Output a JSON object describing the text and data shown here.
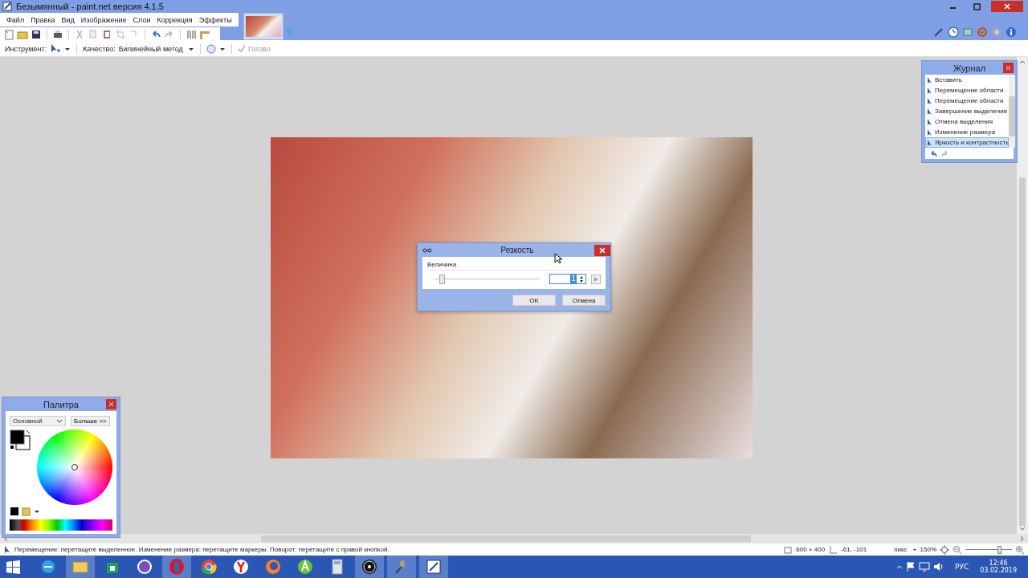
{
  "window": {
    "title": "Безымянный - paint.net версия 4.1.5"
  },
  "menu": [
    "Файл",
    "Правка",
    "Вид",
    "Изображение",
    "Слои",
    "Коррекция",
    "Эффекты"
  ],
  "tool_options": {
    "tool_label": "Инструмент:",
    "quality_label": "Качество:",
    "quality_value": "Билинейный метод",
    "done_label": "Готово"
  },
  "history": {
    "title": "Журнал",
    "items": [
      {
        "label": "Вставить",
        "selected": false
      },
      {
        "label": "Перемещение области",
        "selected": false
      },
      {
        "label": "Перемещение области",
        "selected": false
      },
      {
        "label": "Завершение выделения",
        "selected": false
      },
      {
        "label": "Отмена выделения",
        "selected": false
      },
      {
        "label": "Изменение размера",
        "selected": false
      },
      {
        "label": "Яркость и контрастность",
        "selected": true
      }
    ]
  },
  "palette": {
    "title": "Палитра",
    "mode": "Основной",
    "more_button": "Больше >>"
  },
  "dialog": {
    "title": "Резкость",
    "group_label": "Величина",
    "slider": {
      "level": 0.06
    },
    "value": "1",
    "ok": "OK",
    "cancel": "Отмена"
  },
  "status_bar": {
    "hint": "Перемещение: перетащите выделенное. Изменение размера: перетащите маркеры. Поворот: перетащите с правой кнопкой.",
    "image_size": "600 × 400",
    "cursor": "-61, -101",
    "units": "пикс",
    "zoom": "150%",
    "zoom_slider": {
      "level": 0.72
    }
  },
  "taskbar": {
    "apps": [
      {
        "kind": "ie",
        "running": false
      },
      {
        "kind": "folder",
        "running": true
      },
      {
        "kind": "store",
        "running": false
      },
      {
        "kind": "viber",
        "running": false
      },
      {
        "kind": "opera",
        "running": true
      },
      {
        "kind": "chrome",
        "running": false
      },
      {
        "kind": "yandex",
        "running": false
      },
      {
        "kind": "firefox",
        "running": false
      },
      {
        "kind": "aimp",
        "running": false
      },
      {
        "kind": "calc",
        "running": false
      },
      {
        "kind": "obs",
        "running": true
      },
      {
        "kind": "mic",
        "running": true
      },
      {
        "kind": "paint",
        "running": true
      }
    ],
    "language": "РУС",
    "time": "12:46",
    "date": "03.02.2019"
  }
}
